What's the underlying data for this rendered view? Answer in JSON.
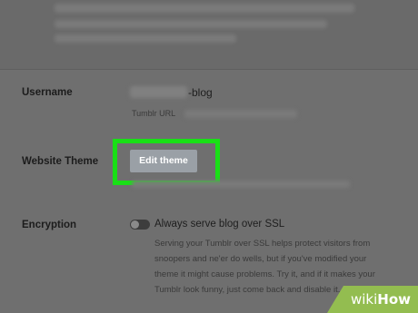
{
  "settings": {
    "username_label": "Username",
    "username_suffix": "-blog",
    "tumblr_url_label": "Tumblr URL",
    "website_theme_label": "Website Theme",
    "edit_theme_label": "Edit theme",
    "encryption_label": "Encryption",
    "ssl_toggle_label": "Always serve blog over SSL",
    "ssl_toggle_on": false,
    "ssl_description_lines": [
      "Serving your Tumblr over SSL helps protect visitors from",
      "snoopers and ne'er do wells, but if you've modified your",
      "theme it might cause problems. Try it, and if it makes your",
      "Tumblr look funny, just come back and disable it."
    ]
  },
  "watermark": {
    "wiki": "wiki",
    "how": "How",
    "color": "#93bd50"
  },
  "colors": {
    "highlight": "#19e016",
    "button": "#9aa0a6"
  }
}
